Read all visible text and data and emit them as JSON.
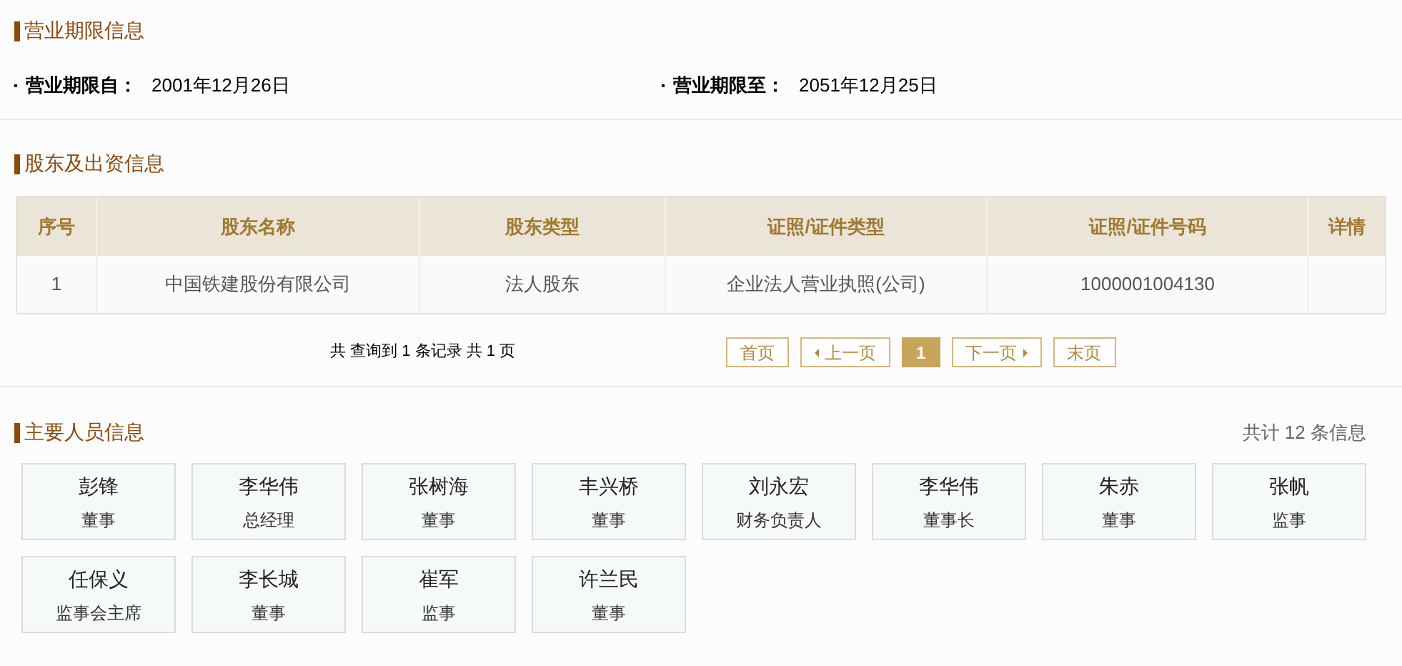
{
  "term_section": {
    "title": "营业期限信息",
    "fields": [
      {
        "label": "营业期限自：",
        "value": "2001年12月26日"
      },
      {
        "label": "营业期限至：",
        "value": "2051年12月25日"
      }
    ]
  },
  "shareholders_section": {
    "title": "股东及出资信息",
    "table": {
      "columns": [
        "序号",
        "股东名称",
        "股东类型",
        "证照/证件类型",
        "证照/证件号码",
        "详情"
      ],
      "rows": [
        [
          "1",
          "中国铁建股份有限公司",
          "法人股东",
          "企业法人营业执照(公司)",
          "1000001004130",
          ""
        ]
      ]
    },
    "pagination": {
      "summary": "共 查询到 1 条记录 共 1 页",
      "buttons": [
        {
          "label": "首页",
          "kind": "first",
          "selected": false
        },
        {
          "label": "上一页",
          "kind": "prev",
          "selected": false
        },
        {
          "label": "1",
          "kind": "page",
          "selected": true
        },
        {
          "label": "下一页",
          "kind": "next",
          "selected": false
        },
        {
          "label": "末页",
          "kind": "last",
          "selected": false
        }
      ]
    }
  },
  "personnel_section": {
    "title": "主要人员信息",
    "count": "共计 12 条信息",
    "people": [
      {
        "name": "彭锋",
        "role": "董事"
      },
      {
        "name": "李华伟",
        "role": "总经理"
      },
      {
        "name": "张树海",
        "role": "董事"
      },
      {
        "name": "丰兴桥",
        "role": "董事"
      },
      {
        "name": "刘永宏",
        "role": "财务负责人"
      },
      {
        "name": "李华伟",
        "role": "董事长"
      },
      {
        "name": "朱赤",
        "role": "董事"
      },
      {
        "name": "张帆",
        "role": "监事"
      },
      {
        "name": "任保义",
        "role": "监事会主席"
      },
      {
        "name": "李长城",
        "role": "董事"
      },
      {
        "name": "崔军",
        "role": "监事"
      },
      {
        "name": "许兰民",
        "role": "董事"
      }
    ]
  }
}
